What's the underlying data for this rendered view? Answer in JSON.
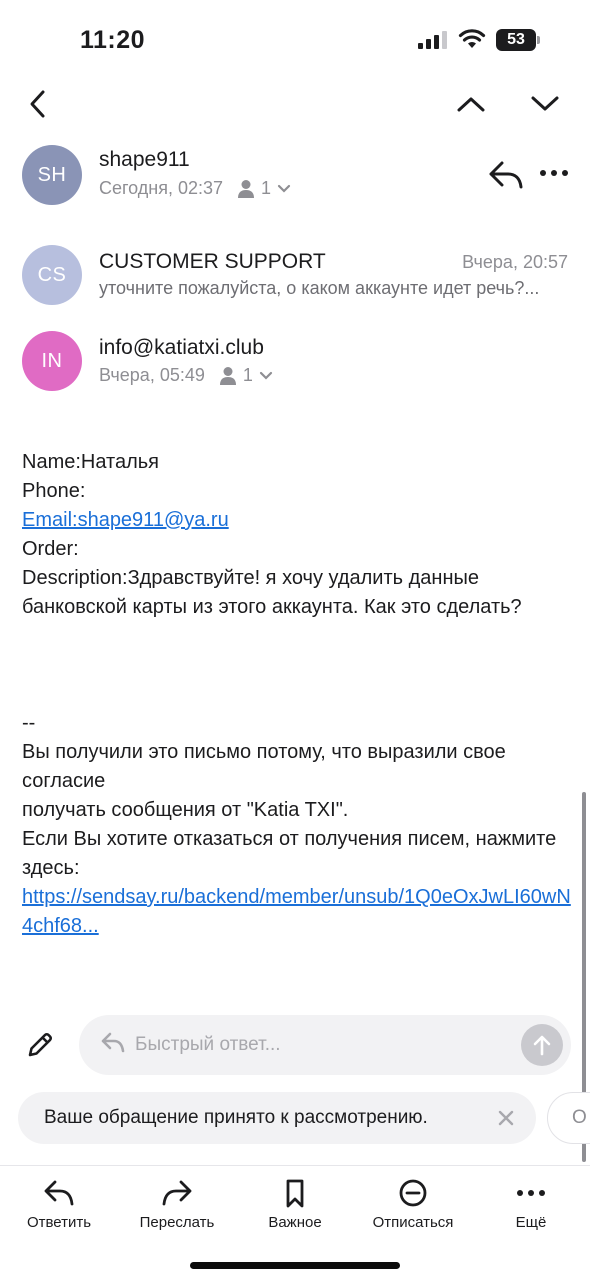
{
  "status_bar": {
    "time": "11:20",
    "battery": "53"
  },
  "thread": [
    {
      "avatar_initials": "SH",
      "avatar_color": "#8a94b6",
      "sender": "shape911",
      "date": "Сегодня, 02:37",
      "recipients_count": "1"
    },
    {
      "avatar_initials": "CS",
      "avatar_color": "#b7bfde",
      "sender": "CUSTOMER SUPPORT",
      "date": "Вчера, 20:57",
      "preview": "уточните пожалуйста, о каком аккаунте идет речь?..."
    },
    {
      "avatar_initials": "IN",
      "avatar_color": "#e06bc4",
      "sender": "info@katiatxi.club",
      "date": "Вчера, 05:49",
      "recipients_count": "1"
    }
  ],
  "body": {
    "name_line": "Name:Наталья",
    "phone_line": "Phone:",
    "email_link": "Email:shape911@ya.ru",
    "order_line": "Order:",
    "description": "Description:Здравствуйте! я хочу удалить данные банковской карты из этого аккаунта. Как это сделать?",
    "separator": "--",
    "footer_line1": "Вы получили это письмо потому, что выразили свое согласие",
    "footer_line2": "получать сообщения от \"Katia TXI\".",
    "footer_line3": "Если Вы хотите отказаться от получения писем, нажмите здесь:",
    "unsubscribe_link": "https://sendsay.ru/backend/member/unsub/1Q0eOxJwLI60wN4chf68..."
  },
  "quick_reply": {
    "placeholder": "Быстрый ответ..."
  },
  "suggestions": [
    {
      "label": "Ваше обращение принято к рассмотрению."
    },
    {
      "label": "О"
    }
  ],
  "toolbar": {
    "reply": "Ответить",
    "forward": "Переслать",
    "important": "Важное",
    "unsubscribe": "Отписаться",
    "more": "Ещё"
  },
  "colors": {
    "link": "#1a6fd8",
    "secondary_text": "#8e8e93",
    "chip_bg": "#f2f2f4"
  }
}
